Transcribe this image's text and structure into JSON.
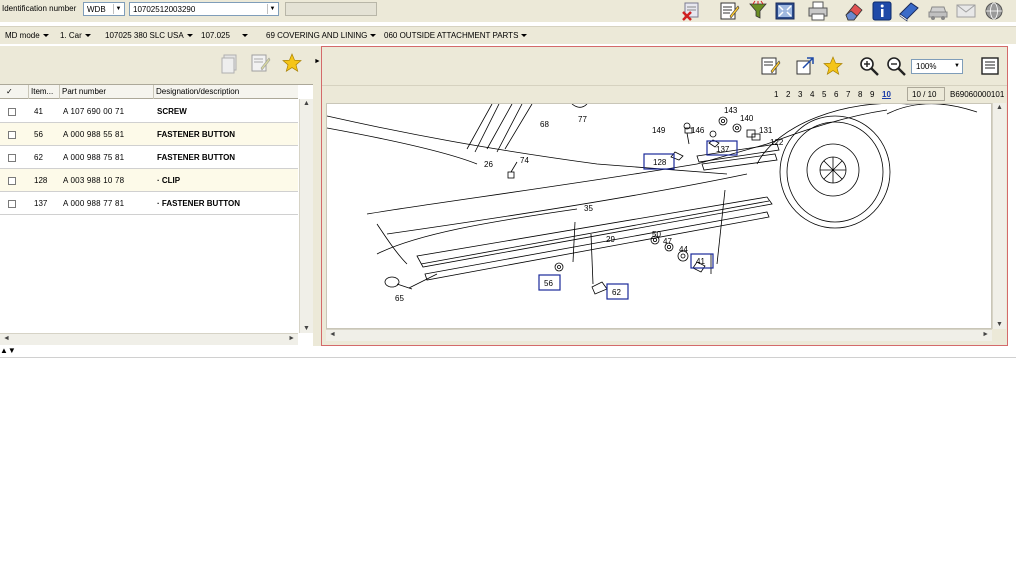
{
  "topbar": {
    "id_label": "Identification number",
    "prefix_value": "WDB",
    "vin_value": "10702512003290",
    "icons": [
      "delete-red-x-icon",
      "edit-notes-icon",
      "filter-funnel-icon",
      "fit-screen-icon",
      "print-icon",
      "eraser-icon",
      "info-icon",
      "manual-book-icon",
      "car-icon",
      "mail-icon",
      "globe-settings-icon"
    ]
  },
  "breadcrumb": [
    "MD mode",
    "1. Car",
    "107025 380 SLC USA",
    "107.025",
    "69 COVERING AND LINING",
    "060 OUTSIDE ATTACHMENT PARTS"
  ],
  "left_toolbar": {
    "icons": [
      "add-to-list-icon",
      "edit-notes-icon",
      "favorite-star-icon"
    ]
  },
  "table": {
    "headers": [
      "✓",
      "Item...",
      "Part number",
      "Designation/description"
    ],
    "rows": [
      {
        "item": "41",
        "part": "A 107 690 00 71",
        "desc": "SCREW"
      },
      {
        "item": "56",
        "part": "A 000 988 55 81",
        "desc": "FASTENER BUTTON"
      },
      {
        "item": "62",
        "part": "A 000 988 75 81",
        "desc": "FASTENER BUTTON"
      },
      {
        "item": "128",
        "part": "A 003 988 10 78",
        "desc": "· CLIP"
      },
      {
        "item": "137",
        "part": "A 000 988 77 81",
        "desc": "· FASTENER BUTTON"
      }
    ]
  },
  "expand_label": "▲▼",
  "right_toolbar": {
    "icons": [
      "edit-notes-icon",
      "open-window-icon",
      "favorite-star-icon",
      "zoom-in-icon",
      "zoom-out-icon",
      "page-view-icon"
    ],
    "zoom": "100%"
  },
  "pagination": {
    "pages": [
      "1",
      "2",
      "3",
      "4",
      "5",
      "6",
      "7",
      "8",
      "9",
      "10"
    ],
    "current": "10",
    "count": "10 / 10",
    "image_id": "B69060000101"
  },
  "diagram": {
    "labels": [
      "68",
      "77",
      "143",
      "140",
      "149",
      "146",
      "131",
      "122",
      "26",
      "74",
      "35",
      "29",
      "50",
      "47",
      "44",
      "65"
    ],
    "boxed_labels": [
      "137",
      "128",
      "41",
      "56",
      "62"
    ]
  },
  "colors": {
    "chrome": "#ece9d8",
    "panel_border": "#d46a6a",
    "hotspot": "#1a2a9a",
    "row_alt": "#fdfae9"
  }
}
